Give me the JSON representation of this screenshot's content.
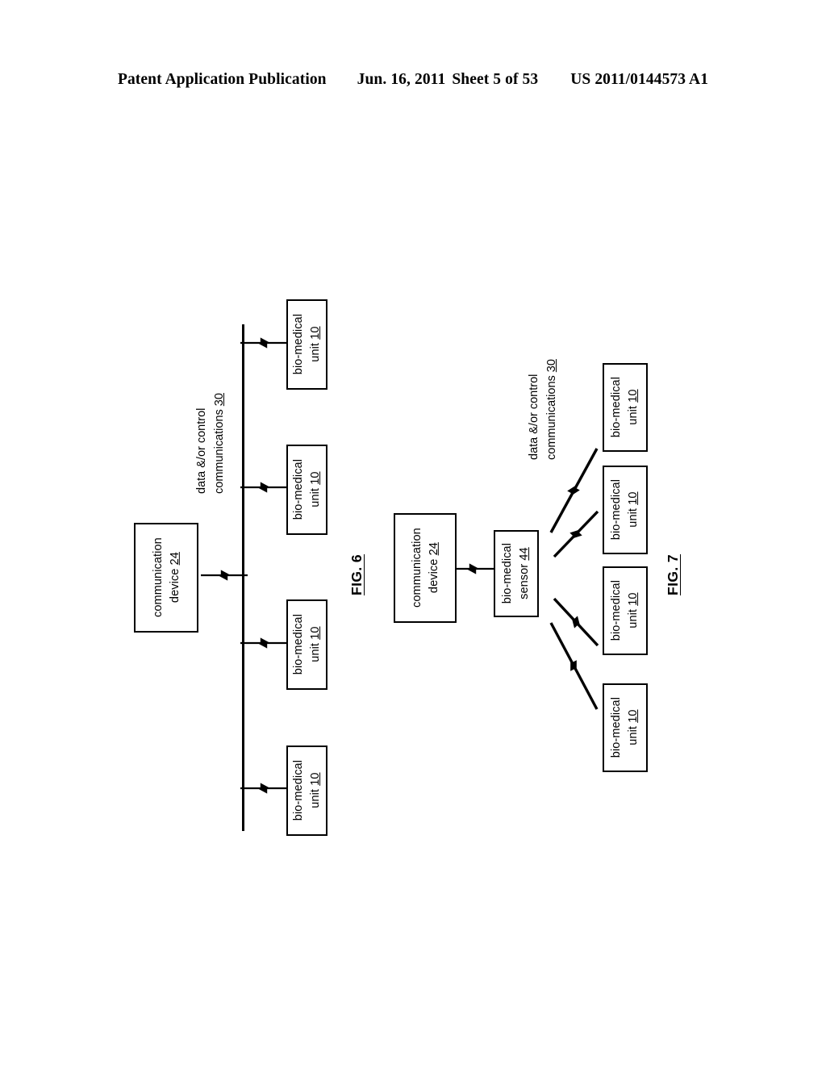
{
  "header": {
    "publication": "Patent Application Publication",
    "date": "Jun. 16, 2011",
    "sheet": "Sheet 5 of 53",
    "patent_number": "US 2011/0144573 A1"
  },
  "figures": [
    {
      "caption": "FIG. 6",
      "topology": "bus",
      "comm_device": {
        "line1": "communication",
        "line2": "device",
        "ref": "24"
      },
      "link_label": {
        "line1": "data &/or control",
        "line2": "communications",
        "ref": "30"
      },
      "units": [
        {
          "line1": "bio-medical",
          "line2": "unit",
          "ref": "10"
        },
        {
          "line1": "bio-medical",
          "line2": "unit",
          "ref": "10"
        },
        {
          "line1": "bio-medical",
          "line2": "unit",
          "ref": "10"
        },
        {
          "line1": "bio-medical",
          "line2": "unit",
          "ref": "10"
        }
      ]
    },
    {
      "caption": "FIG. 7",
      "topology": "star",
      "comm_device": {
        "line1": "communication",
        "line2": "device",
        "ref": "24"
      },
      "sensor": {
        "line1": "bio-medical",
        "line2": "sensor",
        "ref": "44"
      },
      "link_label": {
        "line1": "data &/or control",
        "line2": "communications",
        "ref": "30"
      },
      "units": [
        {
          "line1": "bio-medical",
          "line2": "unit",
          "ref": "10"
        },
        {
          "line1": "bio-medical",
          "line2": "unit",
          "ref": "10"
        },
        {
          "line1": "bio-medical",
          "line2": "unit",
          "ref": "10"
        },
        {
          "line1": "bio-medical",
          "line2": "unit",
          "ref": "10"
        }
      ]
    }
  ],
  "colors": {
    "ink": "#000000",
    "paper": "#ffffff"
  }
}
